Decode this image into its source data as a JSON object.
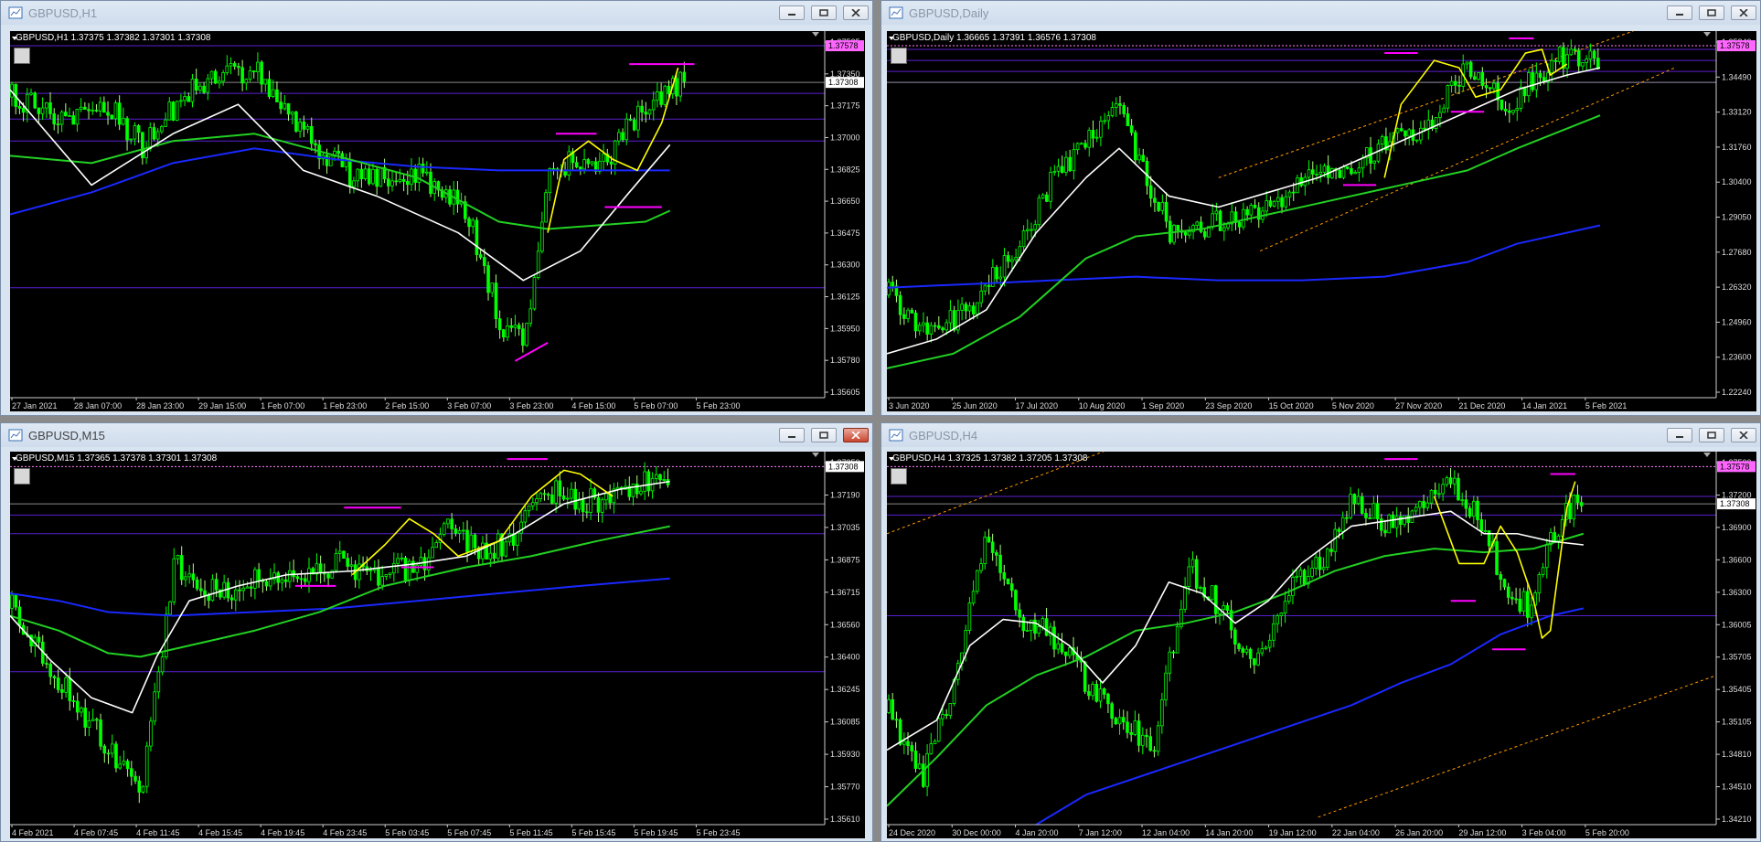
{
  "windows": [
    {
      "id": "h1",
      "title": "GBPUSD,H1",
      "info": "GBPUSD,H1  1.37375 1.37382 1.37301 1.37308",
      "price_labels": [
        "1.37525",
        "1.37350",
        "1.37175",
        "1.37000",
        "1.36825",
        "1.36650",
        "1.36475",
        "1.36300",
        "1.36125",
        "1.35950",
        "1.35780",
        "1.35605"
      ],
      "highlighted_prices": [
        "1.37578",
        "1.37308"
      ],
      "time_labels": [
        "27 Jan 2021",
        "28 Jan 07:00",
        "28 Jan 23:00",
        "29 Jan 15:00",
        "1 Feb 07:00",
        "1 Feb 23:00",
        "2 Feb 15:00",
        "3 Feb 07:00",
        "3 Feb 23:00",
        "4 Feb 15:00",
        "5 Feb 07:00",
        "5 Feb 23:00"
      ]
    },
    {
      "id": "daily",
      "title": "GBPUSD,Daily",
      "info": "GBPUSD,Daily  1.36665 1.37391 1.36576 1.37308",
      "price_labels": [
        "1.35840",
        "1.34490",
        "1.33120",
        "1.31760",
        "1.30400",
        "1.29050",
        "1.27680",
        "1.26320",
        "1.24960",
        "1.23600",
        "1.22240"
      ],
      "highlighted_prices": [
        "1.37578"
      ],
      "time_labels": [
        "3 Jun 2020",
        "25 Jun 2020",
        "17 Jul 2020",
        "10 Aug 2020",
        "1 Sep 2020",
        "23 Sep 2020",
        "15 Oct 2020",
        "5 Nov 2020",
        "27 Nov 2020",
        "21 Dec 2020",
        "14 Jan 2021",
        "5 Feb 2021"
      ]
    },
    {
      "id": "m15",
      "title": "GBPUSD,M15",
      "info": "GBPUSD,M15  1.37365 1.37378 1.37301 1.37308",
      "price_labels": [
        "1.37350",
        "1.37190",
        "1.37035",
        "1.36875",
        "1.36715",
        "1.36560",
        "1.36400",
        "1.36245",
        "1.36085",
        "1.35930",
        "1.35770",
        "1.35610"
      ],
      "highlighted_prices": [
        "1.37308"
      ],
      "time_labels": [
        "4 Feb 2021",
        "4 Feb 07:45",
        "4 Feb 11:45",
        "4 Feb 15:45",
        "4 Feb 19:45",
        "4 Feb 23:45",
        "5 Feb 03:45",
        "5 Feb 07:45",
        "5 Feb 11:45",
        "5 Feb 15:45",
        "5 Feb 19:45",
        "5 Feb 23:45"
      ]
    },
    {
      "id": "h4",
      "title": "GBPUSD,H4",
      "info": "GBPUSD,H4  1.37325 1.37382 1.37205 1.37308",
      "price_labels": [
        "1.37500",
        "1.37200",
        "1.36900",
        "1.36600",
        "1.36300",
        "1.36005",
        "1.35705",
        "1.35405",
        "1.35105",
        "1.34810",
        "1.34510",
        "1.34210"
      ],
      "highlighted_prices": [
        "1.37578",
        "1.37308"
      ],
      "time_labels": [
        "24 Dec 2020",
        "30 Dec 00:00",
        "4 Jan 20:00",
        "7 Jan 12:00",
        "12 Jan 04:00",
        "14 Jan 20:00",
        "19 Jan 12:00",
        "22 Jan 04:00",
        "26 Jan 20:00",
        "29 Jan 12:00",
        "3 Feb 04:00",
        "5 Feb 20:00"
      ]
    }
  ],
  "icons": {
    "app": "chart-app-icon",
    "minimize": "minimize-icon",
    "restore": "restore-icon",
    "close": "close-icon",
    "hand": "hand-tool-icon"
  },
  "colors": {
    "bull": "#00ff00",
    "bear": "#b0ff80",
    "ma_white": "#ffffff",
    "ma_green": "#22d022",
    "ma_blue": "#1a28ff",
    "zigzag": "#ffff00",
    "level": "#ff00ff",
    "hline_purple": "#5a1fd0",
    "channel": "#ff9900"
  }
}
